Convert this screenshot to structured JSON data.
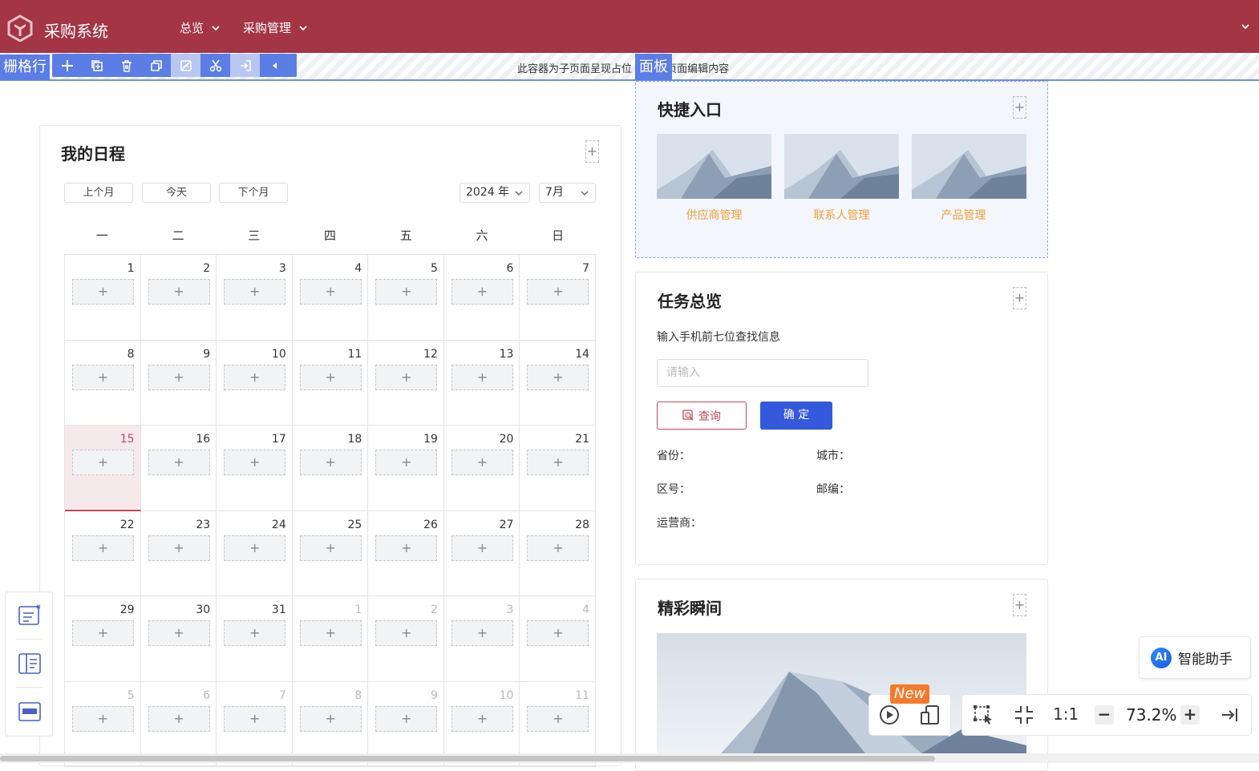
{
  "header": {
    "app_title": "采购系统",
    "nav": [
      {
        "label": "总览"
      },
      {
        "label": "采购管理"
      }
    ]
  },
  "editor": {
    "grid_row_tag": "栅格行",
    "placeholder_text": "此容器为子页面呈现占位 可在子页面编辑内容",
    "panel_tag": "面板",
    "tools": [
      "add-icon",
      "copy-icon",
      "delete-icon",
      "duplicate-icon",
      "clear-style-icon",
      "cut-icon",
      "move-in-icon",
      "collapse-left-icon"
    ]
  },
  "calendar": {
    "title": "我的日程",
    "prev_month": "上个月",
    "today": "今天",
    "next_month": "下个月",
    "year_select": "2024 年",
    "month_select": "7月",
    "weekdays": [
      "一",
      "二",
      "三",
      "四",
      "五",
      "六",
      "日"
    ],
    "weeks": [
      [
        "1",
        "2",
        "3",
        "4",
        "5",
        "6",
        "7"
      ],
      [
        "8",
        "9",
        "10",
        "11",
        "12",
        "13",
        "14"
      ],
      [
        "15",
        "16",
        "17",
        "18",
        "19",
        "20",
        "21"
      ],
      [
        "22",
        "23",
        "24",
        "25",
        "26",
        "27",
        "28"
      ],
      [
        "29",
        "30",
        "31",
        "1",
        "2",
        "3",
        "4"
      ],
      [
        "5",
        "6",
        "7",
        "8",
        "9",
        "10",
        "11"
      ]
    ],
    "today_date": "15",
    "slot_symbol": "+"
  },
  "quick": {
    "title": "快捷入口",
    "items": [
      {
        "label": "供应商管理"
      },
      {
        "label": "联系人管理"
      },
      {
        "label": "产品管理"
      }
    ]
  },
  "task": {
    "title": "任务总览",
    "hint": "输入手机前七位查找信息",
    "input_placeholder": "请输入",
    "query_button": "查询",
    "confirm_button": "确 定",
    "fields": {
      "province": "省份：",
      "city": "城市：",
      "area_code": "区号：",
      "postcode": "邮编：",
      "carrier": "运营商："
    }
  },
  "highlights": {
    "title": "精彩瞬间"
  },
  "add_symbol": "+",
  "ai_assistant": {
    "badge": "AI",
    "label": "智能助手"
  },
  "bottom": {
    "new_badge": "New",
    "ratio_button": "1:1",
    "zoom_minus": "−",
    "zoom_value": "73.2%",
    "zoom_plus": "+"
  },
  "colors": {
    "brand": "#a33545",
    "accent": "#5b7de6",
    "primary_button": "#3459db",
    "quick_label": "#f0a23b",
    "today_highlight": "#c9485a"
  }
}
